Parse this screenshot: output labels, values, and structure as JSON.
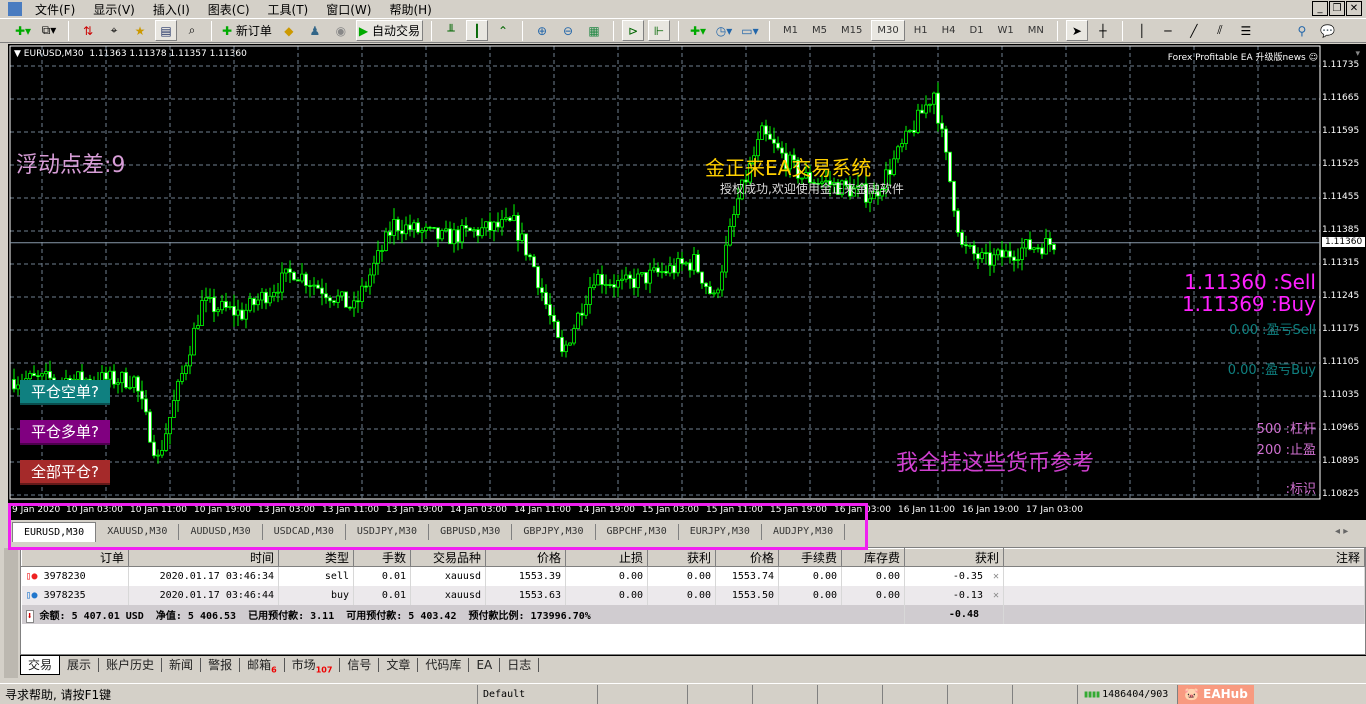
{
  "menu": [
    "文件(F)",
    "显示(V)",
    "插入(I)",
    "图表(C)",
    "工具(T)",
    "窗口(W)",
    "帮助(H)"
  ],
  "toolbar": {
    "new_order": "新订单",
    "auto_trading": "自动交易",
    "timeframes": [
      "M1",
      "M5",
      "M15",
      "M30",
      "H1",
      "H4",
      "D1",
      "W1",
      "MN"
    ],
    "active_timeframe": "M30"
  },
  "chart": {
    "header": "EURUSD,M30  1.11363 1.11378 1.11357 1.11360",
    "ea_label": "Forex Profitable EA 升级版news ☺",
    "spread": "浮动点差:9",
    "title": "金正来EA交易系统",
    "subtitle": "授权成功,欢迎使用金正来金融软件",
    "sell_price": "1.11360 :Sell",
    "buy_price": "1.11369 :Buy",
    "pl_sell": "0.00 :盈亏Sell",
    "pl_buy": "0.00 :盈亏Buy",
    "leverage": "500 :杠杆",
    "take_profit": "200 :止盈",
    "marker": ":标识",
    "note": "我全挂这些货币参考",
    "buttons": [
      "平仓空单?",
      "平仓多单?",
      "全部平仓?"
    ],
    "button_colors": [
      "#0f8080",
      "#800080",
      "#a52a2a"
    ],
    "current_price": "1.11360",
    "price_labels": [
      "1.11735",
      "1.11665",
      "1.11595",
      "1.11525",
      "1.11455",
      "1.11385",
      "1.11315",
      "1.11245",
      "1.11175",
      "1.11105",
      "1.11035",
      "1.10965",
      "1.10895",
      "1.10825"
    ],
    "time_labels": [
      "9 Jan 2020",
      "10 Jan 03:00",
      "10 Jan 11:00",
      "10 Jan 19:00",
      "13 Jan 03:00",
      "13 Jan 11:00",
      "13 Jan 19:00",
      "14 Jan 03:00",
      "14 Jan 11:00",
      "14 Jan 19:00",
      "15 Jan 03:00",
      "15 Jan 11:00",
      "15 Jan 19:00",
      "16 Jan 03:00",
      "16 Jan 11:00",
      "16 Jan 19:00",
      "17 Jan 03:00"
    ]
  },
  "chart_data": {
    "type": "candlestick",
    "symbol": "EURUSD",
    "timeframe": "M30",
    "ylim": [
      1.108,
      1.1176
    ],
    "anchors_bar": [
      0,
      30,
      36,
      47,
      57,
      70,
      85,
      95,
      107,
      125,
      130,
      137,
      145,
      152,
      170,
      175,
      181,
      187,
      197,
      215,
      230,
      237,
      243,
      253,
      260
    ],
    "anchors_close": [
      1.1107,
      1.1107,
      1.109,
      1.1123,
      1.1121,
      1.113,
      1.1122,
      1.114,
      1.1137,
      1.114,
      1.1131,
      1.1112,
      1.1129,
      1.1127,
      1.1132,
      1.1124,
      1.1145,
      1.1159,
      1.115,
      1.1146,
      1.1168,
      1.1135,
      1.1132,
      1.1135,
      1.1136
    ]
  },
  "symbol_tabs": [
    "EURUSD,M30",
    "XAUUSD,M30",
    "AUDUSD,M30",
    "USDCAD,M30",
    "USDJPY,M30",
    "GBPUSD,M30",
    "GBPJPY,M30",
    "GBPCHF,M30",
    "EURJPY,M30",
    "AUDJPY,M30"
  ],
  "orders": {
    "headers": [
      "订单",
      "时间",
      "类型",
      "手数",
      "交易品种",
      "价格",
      "止损",
      "获利",
      "价格",
      "手续费",
      "库存费",
      "获利",
      "注释"
    ],
    "rows": [
      [
        "3978230",
        "2020.01.17 03:46:34",
        "sell",
        "0.01",
        "xauusd",
        "1553.39",
        "0.00",
        "0.00",
        "1553.74",
        "0.00",
        "0.00",
        "-0.35",
        ""
      ],
      [
        "3978235",
        "2020.01.17 03:46:44",
        "buy",
        "0.01",
        "xauusd",
        "1553.63",
        "0.00",
        "0.00",
        "1553.50",
        "0.00",
        "0.00",
        "-0.13",
        ""
      ]
    ],
    "summary": "余额: 5 407.01 USD  净值: 5 406.53  已用预付款: 3.11  可用预付款: 5 403.42  预付款比例: 173996.70%",
    "total_profit": "-0.48"
  },
  "terminal_tabs": [
    {
      "label": "交易"
    },
    {
      "label": "展示"
    },
    {
      "label": "账户历史"
    },
    {
      "label": "新闻"
    },
    {
      "label": "警报"
    },
    {
      "label": "邮箱",
      "badge": "6"
    },
    {
      "label": "市场",
      "badge": "107"
    },
    {
      "label": "信号"
    },
    {
      "label": "文章"
    },
    {
      "label": "代码库"
    },
    {
      "label": "EA"
    },
    {
      "label": "日志"
    }
  ],
  "status": {
    "help": "寻求帮助, 请按F1键",
    "profile": "Default",
    "traffic": "1486404/903",
    "watermark": "EAHub"
  }
}
